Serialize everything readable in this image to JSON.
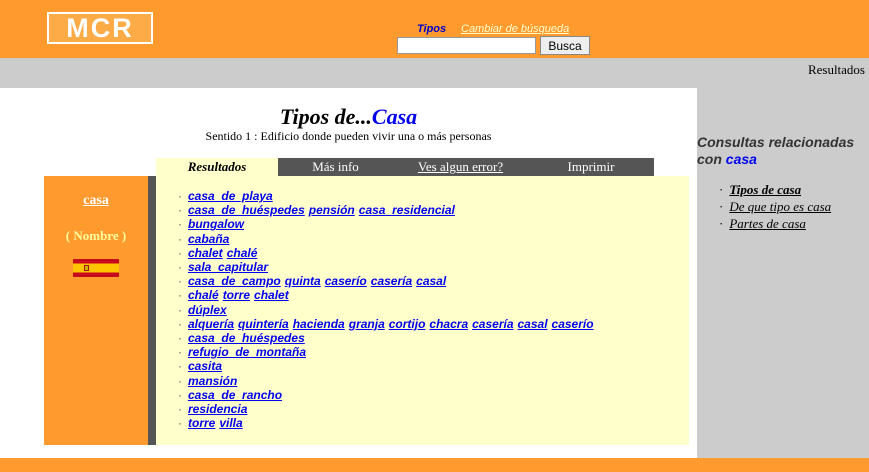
{
  "header": {
    "logo_text": "MCR",
    "nav_tipos": "Tipos",
    "nav_cambiar": "Cambiar de búsqueda",
    "search_value": "",
    "search_button": "Busca"
  },
  "greybar": {
    "label": "Resultados"
  },
  "title": {
    "prefix": "Tipos de...",
    "term": "Casa"
  },
  "sense": "Sentido 1 : Edificio donde pueden vivir una o más personas",
  "tabs": [
    {
      "label": "Resultados"
    },
    {
      "label": "Más info"
    },
    {
      "label": "Ves algun error?"
    },
    {
      "label": "Imprimir"
    }
  ],
  "word_panel": {
    "word": "casa",
    "pos": "( Nombre )",
    "flag_icon": "spain-flag-icon"
  },
  "results": [
    [
      "casa_de_playa"
    ],
    [
      "casa_de_huéspedes",
      "pensión",
      "casa_residencial"
    ],
    [
      "bungalow"
    ],
    [
      "cabaña"
    ],
    [
      "chalet",
      "chalé"
    ],
    [
      "sala_capitular"
    ],
    [
      "casa_de_campo",
      "quinta",
      "caserío",
      "casería",
      "casal"
    ],
    [
      "chalé",
      "torre",
      "chalet"
    ],
    [
      "dúplex"
    ],
    [
      "alquería",
      "quintería",
      "hacienda",
      "granja",
      "cortijo",
      "chacra",
      "casería",
      "casal",
      "caserío"
    ],
    [
      "casa_de_huéspedes"
    ],
    [
      "refugio_de_montaña"
    ],
    [
      "casita"
    ],
    [
      "mansión"
    ],
    [
      "casa_de_rancho"
    ],
    [
      "residencia"
    ],
    [
      "torre",
      "villa"
    ]
  ],
  "related": {
    "title": "Consultas relacionadas con",
    "term": "casa",
    "items": [
      {
        "label": "Tipos de casa",
        "bold": true
      },
      {
        "label": "De que tipo es casa",
        "bold": false
      },
      {
        "label": "Partes de casa",
        "bold": false
      }
    ]
  },
  "colors": {
    "orange": "#fe9a2e",
    "grey": "#cccccc",
    "dark_grey": "#555555",
    "cream": "#ffffcc",
    "link_blue": "#0000ee"
  }
}
